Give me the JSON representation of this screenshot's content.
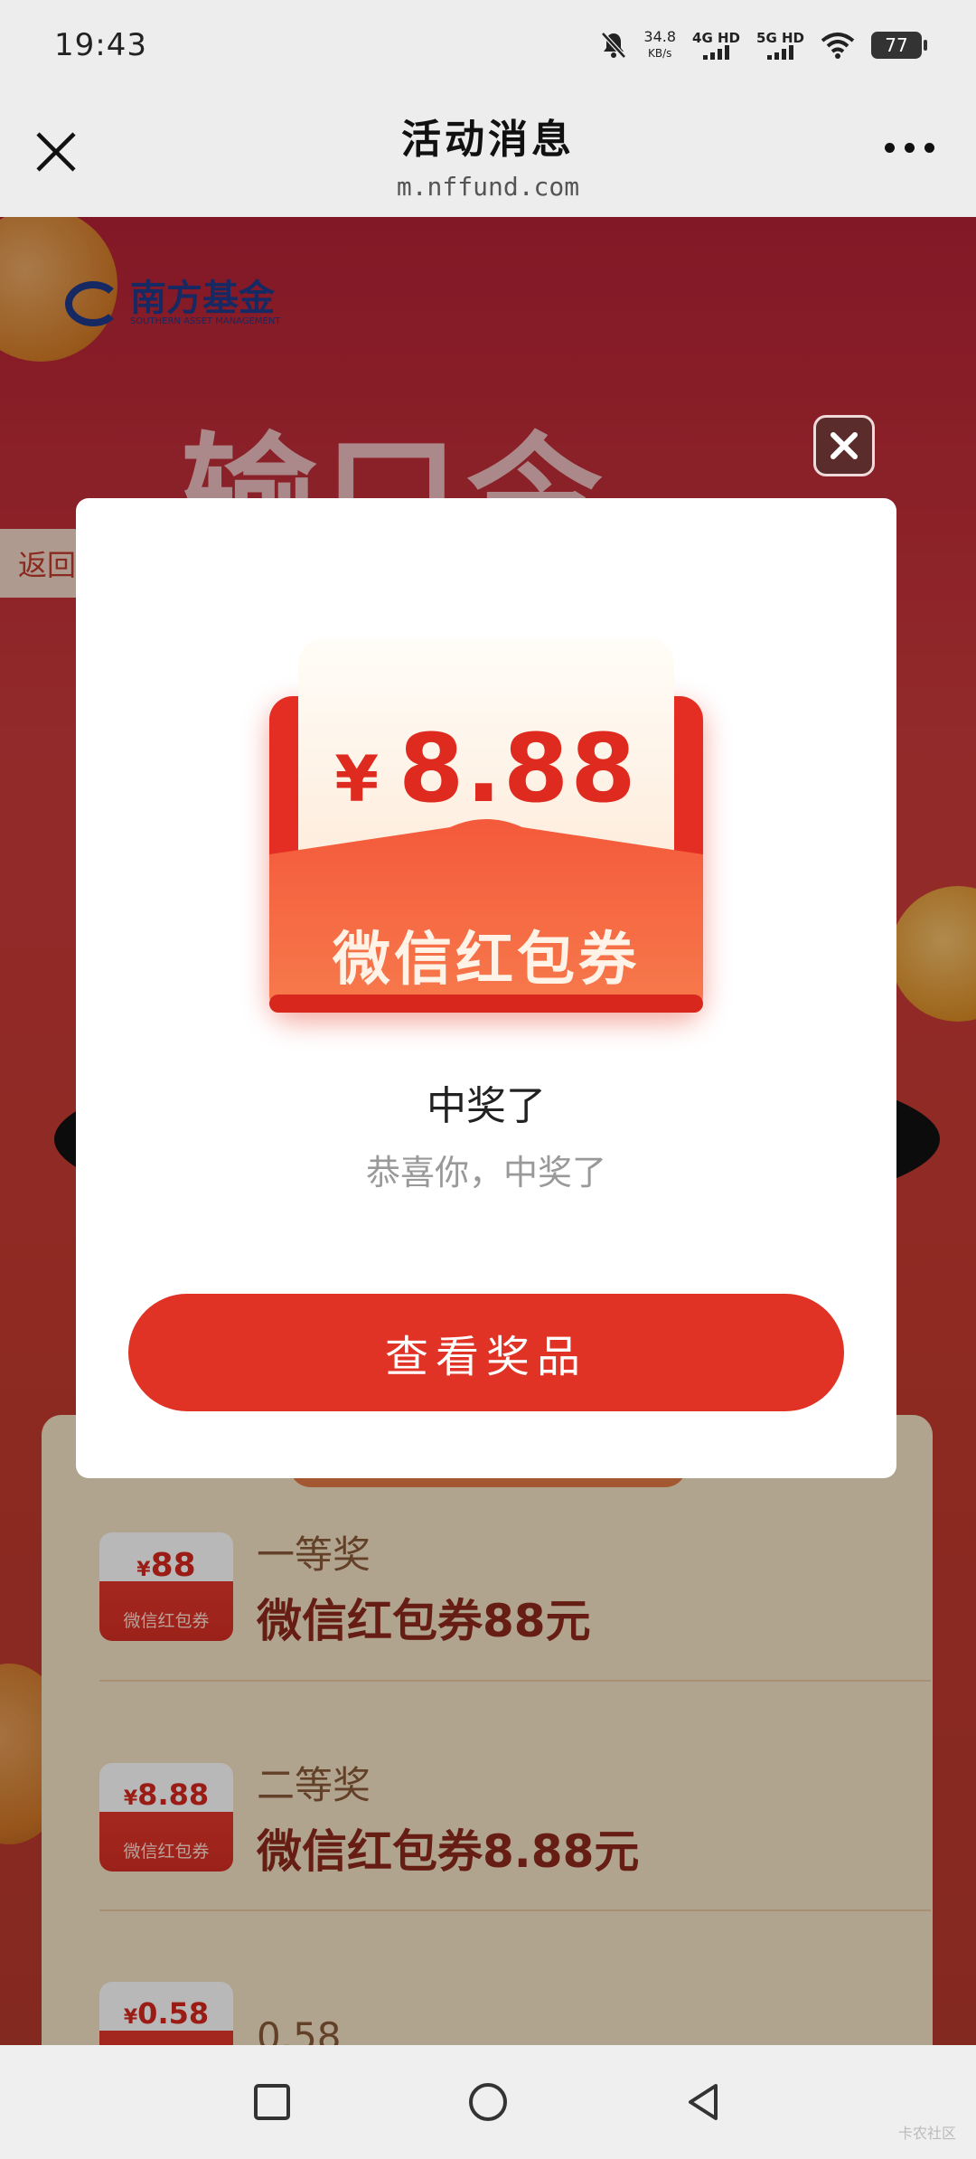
{
  "status_bar": {
    "time": "19:43",
    "net_speed_value": "34.8",
    "net_speed_unit": "KB/s",
    "signal_1": "4G HD",
    "signal_2": "5G HD",
    "battery": "77"
  },
  "title_bar": {
    "title": "活动消息",
    "url": "m.nffund.com"
  },
  "page": {
    "logo_text": "南方基金",
    "logo_subtext": "SOUTHERN ASSET MANAGEMENT",
    "banner_title": "输口令",
    "back_label": "返回",
    "prizes": [
      {
        "amount_symbol": "¥",
        "amount": "88",
        "envelope_label": "微信红包券",
        "rank": "一等奖",
        "name": "微信红包券88元"
      },
      {
        "amount_symbol": "¥",
        "amount": "8.88",
        "envelope_label": "微信红包券",
        "rank": "二等奖",
        "name": "微信红包券8.88元"
      },
      {
        "amount_symbol": "¥",
        "amount": "0.58",
        "envelope_label": "",
        "rank": "0.58",
        "name": ""
      }
    ]
  },
  "modal": {
    "red_packet_symbol": "¥",
    "red_packet_amount": "8.88",
    "red_packet_label": "微信红包券",
    "title": "中奖了",
    "subtitle": "恭喜你，中奖了",
    "button_label": "查看奖品"
  },
  "watermark": "卡农社区",
  "colors": {
    "accent": "#e13226",
    "modal_bg": "#ffffff"
  }
}
